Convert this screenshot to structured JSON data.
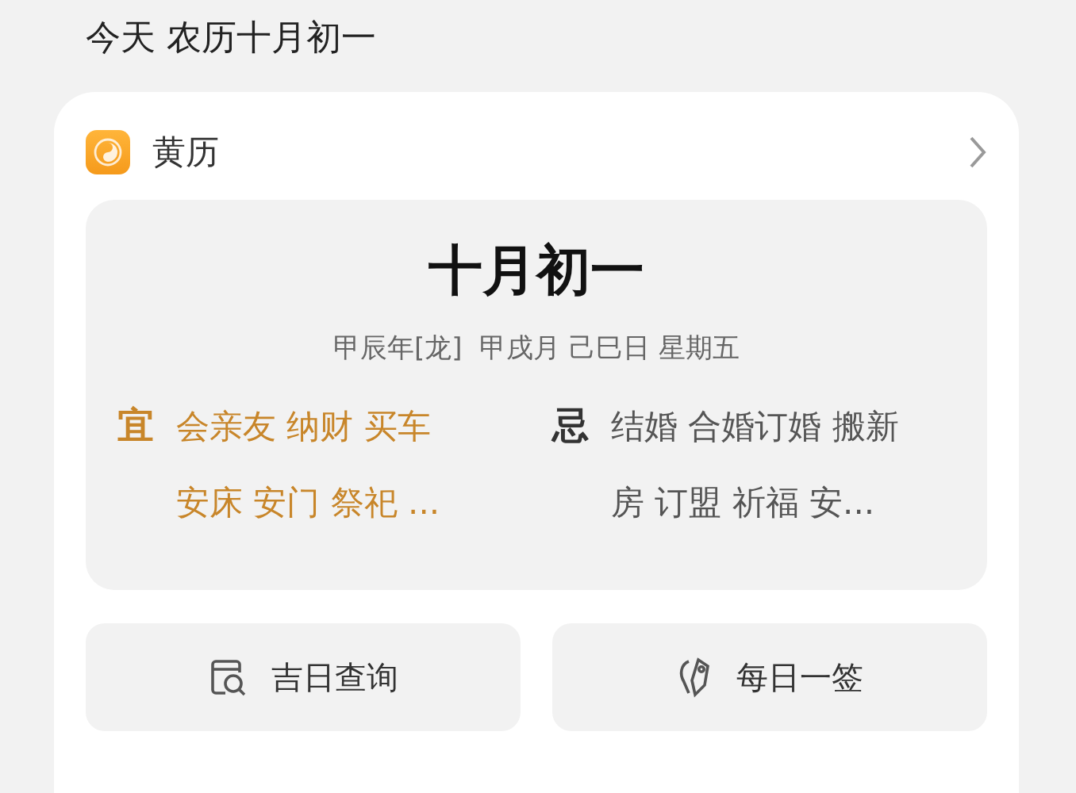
{
  "header": {
    "title": "今天 农历十月初一"
  },
  "card": {
    "title": "黄历",
    "date": "十月初一",
    "details": "甲辰年[龙]  甲戌月 己巳日 星期五",
    "sections": [
      {
        "kind": "good",
        "label": "宜",
        "lines": [
          "会亲友 纳财 买车",
          "安床 安门 祭祀 ..."
        ]
      },
      {
        "kind": "bad",
        "label": "忌",
        "lines": [
          "结婚 合婚订婚 搬新",
          "房 订盟 祈福 安..."
        ]
      }
    ],
    "buttons": [
      {
        "kind": "calendar",
        "label": "吉日查询"
      },
      {
        "kind": "lot",
        "label": "每日一签"
      }
    ]
  }
}
